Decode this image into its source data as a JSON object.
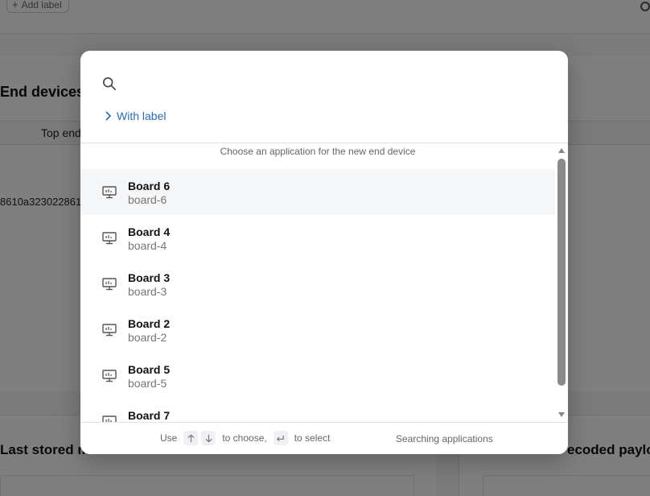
{
  "background": {
    "add_label": "Add label",
    "section_title": "End devices",
    "tab_label": "Top end",
    "device_eui_fragment": "8610a323022861",
    "last_stored_title": "Last stored m",
    "decoded_payload_title": "ecoded payloa"
  },
  "modal": {
    "search": {
      "placeholder": "",
      "value": ""
    },
    "with_label": "With label",
    "list_header": "Choose an application for the new end device",
    "items": [
      {
        "name": "Board 6",
        "id": "board-6",
        "active": true
      },
      {
        "name": "Board 4",
        "id": "board-4",
        "active": false
      },
      {
        "name": "Board 3",
        "id": "board-3",
        "active": false
      },
      {
        "name": "Board 2",
        "id": "board-2",
        "active": false
      },
      {
        "name": "Board 5",
        "id": "board-5",
        "active": false
      },
      {
        "name": "Board 7",
        "id": "",
        "active": false
      }
    ],
    "footer": {
      "use": "Use",
      "to_choose": "to choose,",
      "to_select": "to select",
      "status": "Searching applications"
    }
  },
  "icons": {
    "search": "search-icon",
    "chevron": "chevron-right-icon",
    "device": "monitor-icon",
    "arrow_up": "arrow-up-icon",
    "arrow_down": "arrow-down-icon",
    "enter": "enter-key-icon"
  },
  "colors": {
    "link": "#2b6cb0",
    "active_row": "#f5f6f8",
    "overlay": "rgba(0,0,0,0.5)"
  }
}
